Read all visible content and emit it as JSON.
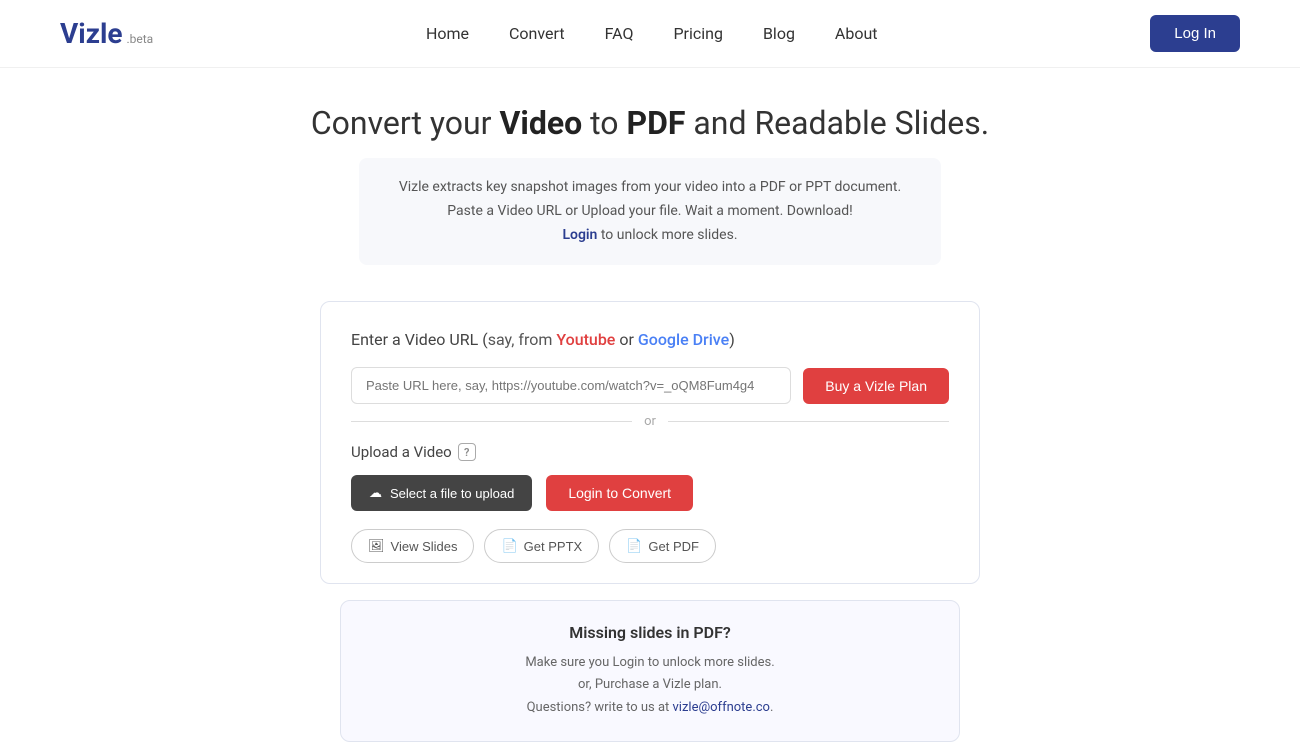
{
  "header": {
    "logo": "Vizle",
    "beta": ".beta",
    "nav": {
      "home": "Home",
      "convert": "Convert",
      "faq": "FAQ",
      "pricing": "Pricing",
      "blog": "Blog",
      "about": "About"
    },
    "login_button": "Log In"
  },
  "hero": {
    "title_plain": "Convert your ",
    "title_bold1": "Video",
    "title_to": " to ",
    "title_bold2": "PDF",
    "title_end": " and Readable Slides.",
    "desc_line1": "Vizle extracts key snapshot images from your video into a PDF or PPT document.",
    "desc_line2": "Paste a Video URL or Upload your file. Wait a moment. Download!",
    "desc_line3_pre": "",
    "desc_login": "Login",
    "desc_line3_post": " to unlock more slides."
  },
  "main_card": {
    "title_pre": "Enter a Video URL (",
    "title_say": "say, ",
    "title_from": "from ",
    "title_youtube": "Youtube",
    "title_or": " or ",
    "title_gdrive": "Google Drive",
    "title_close": ")",
    "url_placeholder": "Paste URL here, say, https://youtube.com/watch?v=_oQM8Fum4g4",
    "buy_button": "Buy a Vizle Plan",
    "divider_or": "or",
    "upload_title": "Upload a Video",
    "select_file_button": "Select a file to upload",
    "login_convert_button": "Login to Convert",
    "view_slides_button": "View Slides",
    "get_pptx_button": "Get PPTX",
    "get_pdf_button": "Get PDF"
  },
  "missing_slides": {
    "title": "Missing slides in PDF?",
    "line1": "Make sure you Login to unlock more slides.",
    "line2_pre": "or, Purchase a Vizle plan.",
    "line3_pre": "Questions? write to us at ",
    "email": "vizle@offnote.co",
    "line3_post": "."
  },
  "colors": {
    "brand_blue": "#2c3e90",
    "brand_red": "#e04040",
    "youtube_red": "#e04040",
    "gdrive_blue": "#4a80f5"
  }
}
